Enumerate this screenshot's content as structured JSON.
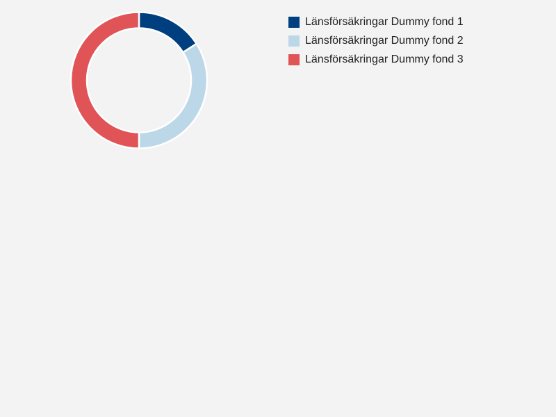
{
  "chart_data": {
    "type": "pie",
    "donut": true,
    "series": [
      {
        "name": "Länsförsäkringar Dummy fond 1",
        "value": 16,
        "color": "#003f7f"
      },
      {
        "name": "Länsförsäkringar Dummy fond 2",
        "value": 34,
        "color": "#bcd8e8"
      },
      {
        "name": "Länsförsäkringar Dummy fond 3",
        "value": 50,
        "color": "#e05458"
      }
    ],
    "legend": {
      "position": "right"
    },
    "background": "#f3f3f3",
    "slice_border_color": "#ffffff"
  }
}
